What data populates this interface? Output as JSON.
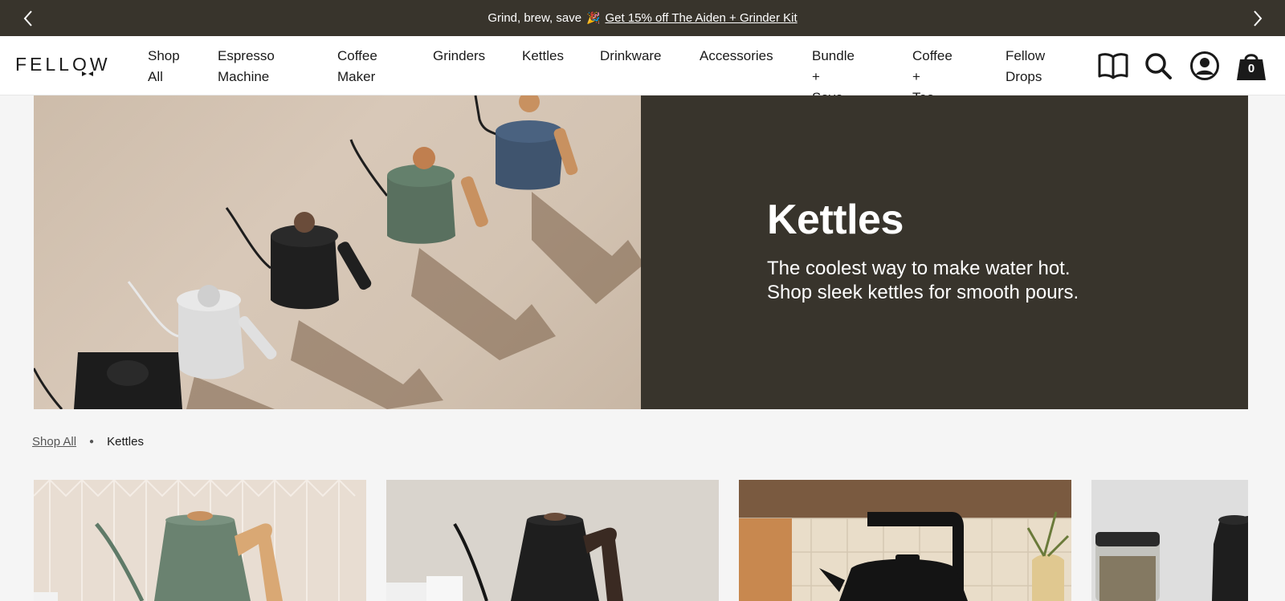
{
  "announcement": {
    "text": "Grind, brew, save",
    "link_text": "Get 15% off The Aiden + Grinder Kit",
    "prev_icon": "chevron-left-icon",
    "next_icon": "chevron-right-icon"
  },
  "header": {
    "logo": "FELLOW",
    "nav": [
      {
        "line1": "Shop",
        "line2": "All"
      },
      {
        "line1": "Espresso",
        "line2": "Machine"
      },
      {
        "line1": "Coffee",
        "line2": "Maker"
      },
      {
        "line1": "Grinders",
        "line2": ""
      },
      {
        "line1": "Kettles",
        "line2": ""
      },
      {
        "line1": "Drinkware",
        "line2": ""
      },
      {
        "line1": "Accessories",
        "line2": ""
      },
      {
        "line1": "Bundle +",
        "line2": "Save"
      },
      {
        "line1": "Coffee +",
        "line2": "Tea"
      },
      {
        "line1": "Fellow",
        "line2": "Drops"
      }
    ],
    "icons": [
      "book-icon",
      "search-icon",
      "account-icon",
      "cart-icon"
    ],
    "cart_count": "0"
  },
  "hero": {
    "title": "Kettles",
    "subtitle_line1": "The coolest way to make water hot.",
    "subtitle_line2": "Shop sleek kettles for smooth pours."
  },
  "breadcrumb": {
    "home": "Shop All",
    "current": "Kettles"
  },
  "colors": {
    "bar": "#38342c",
    "background": "#f5f5f5"
  }
}
